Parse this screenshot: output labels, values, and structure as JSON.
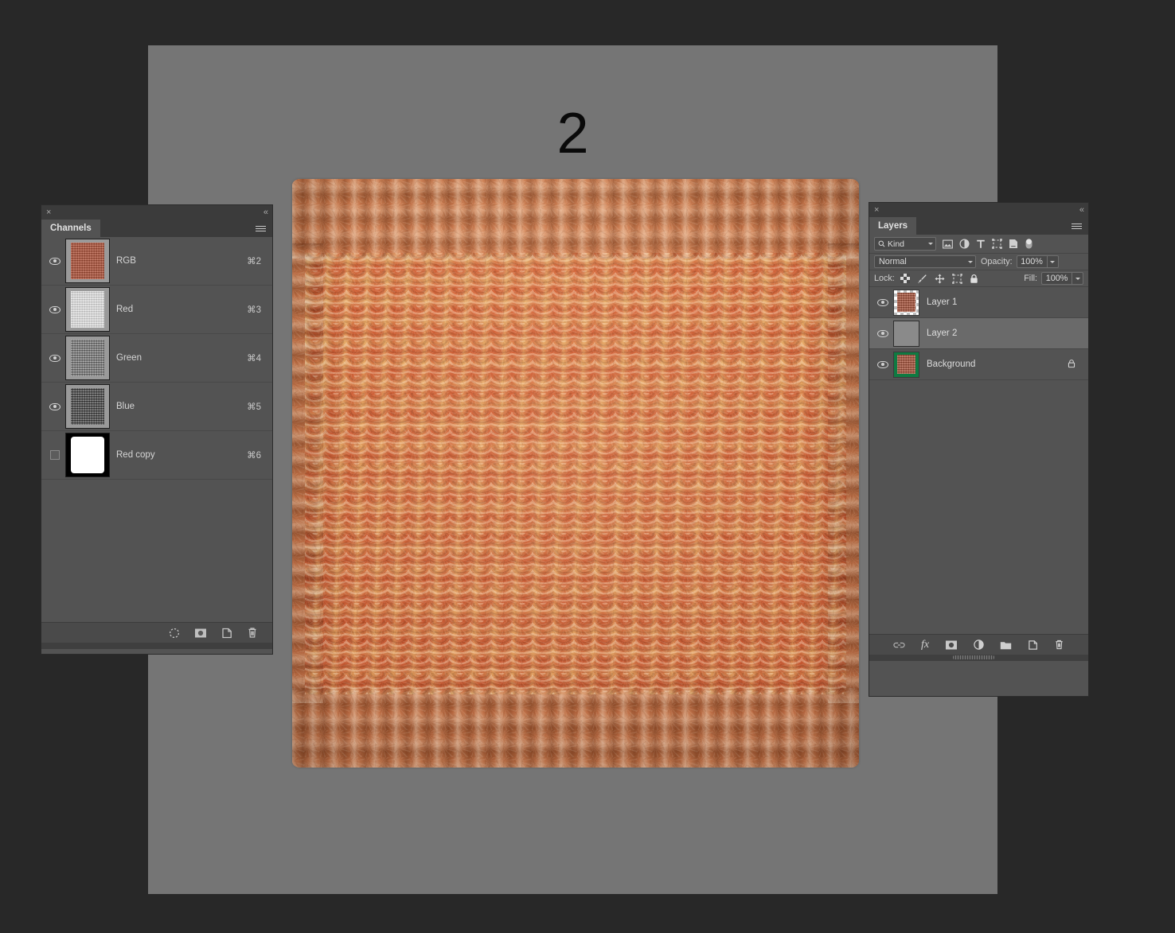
{
  "workspace": {
    "app_background_color": "#282828",
    "canvas_background_color": "#757575",
    "canvas_label": "2"
  },
  "channels_panel": {
    "title": "Channels",
    "close_icon": "×",
    "collapse_icon": "«",
    "menu_icon": "panel-menu-icon",
    "rows": [
      {
        "name": "RGB",
        "shortcut": "⌘2",
        "visible": true,
        "thumb": "rgb-composite"
      },
      {
        "name": "Red",
        "shortcut": "⌘3",
        "visible": true,
        "thumb": "red-channel"
      },
      {
        "name": "Green",
        "shortcut": "⌘4",
        "visible": true,
        "thumb": "green-channel"
      },
      {
        "name": "Blue",
        "shortcut": "⌘5",
        "visible": true,
        "thumb": "blue-channel"
      },
      {
        "name": "Red copy",
        "shortcut": "⌘6",
        "visible": false,
        "thumb": "alpha-mask"
      }
    ],
    "footer_buttons": [
      {
        "name": "load-channel-as-selection",
        "icon": "dashed-circle-icon"
      },
      {
        "name": "save-selection-as-channel",
        "icon": "mask-icon"
      },
      {
        "name": "create-new-channel",
        "icon": "new-page-icon"
      },
      {
        "name": "delete-channel",
        "icon": "trash-icon"
      }
    ]
  },
  "layers_panel": {
    "title": "Layers",
    "close_icon": "×",
    "collapse_icon": "«",
    "menu_icon": "panel-menu-icon",
    "filter": {
      "label": "Kind",
      "search_icon": "search-icon",
      "type_filters": [
        {
          "name": "filter-pixel-layers",
          "icon": "image-icon"
        },
        {
          "name": "filter-adjustment-layers",
          "icon": "half-circle-icon"
        },
        {
          "name": "filter-type-layers",
          "icon": "type-t-icon"
        },
        {
          "name": "filter-shape-layers",
          "icon": "shape-icon"
        },
        {
          "name": "filter-smart-objects",
          "icon": "smart-object-icon"
        }
      ],
      "toggle_icon": "filter-toggle-switch"
    },
    "blend_mode": "Normal",
    "opacity_label": "Opacity:",
    "opacity_value": "100%",
    "lock_label": "Lock:",
    "lock_icons": [
      {
        "name": "lock-transparent-pixels",
        "icon": "checkerboard-icon"
      },
      {
        "name": "lock-image-pixels",
        "icon": "brush-icon"
      },
      {
        "name": "lock-position",
        "icon": "move-arrows-icon"
      },
      {
        "name": "lock-artboard-nesting",
        "icon": "artboard-icon"
      },
      {
        "name": "lock-all",
        "icon": "padlock-icon"
      }
    ],
    "fill_label": "Fill:",
    "fill_value": "100%",
    "rows": [
      {
        "name": "Layer 1",
        "visible": true,
        "selected": false,
        "locked": false,
        "thumb": "knit-on-transparent"
      },
      {
        "name": "Layer 2",
        "visible": true,
        "selected": true,
        "locked": false,
        "thumb": "gray-fill"
      },
      {
        "name": "Background",
        "visible": true,
        "selected": false,
        "locked": true,
        "thumb": "knit-on-green",
        "lock_icon": "padlock-icon"
      }
    ],
    "footer_buttons": [
      {
        "name": "link-layers",
        "icon": "link-icon"
      },
      {
        "name": "add-layer-style",
        "icon": "fx-icon",
        "label": "fx"
      },
      {
        "name": "add-layer-mask",
        "icon": "mask-icon"
      },
      {
        "name": "new-adjustment-layer",
        "icon": "half-circle-icon"
      },
      {
        "name": "new-group",
        "icon": "folder-icon"
      },
      {
        "name": "new-layer",
        "icon": "new-page-icon"
      },
      {
        "name": "delete-layer",
        "icon": "trash-icon"
      }
    ]
  }
}
